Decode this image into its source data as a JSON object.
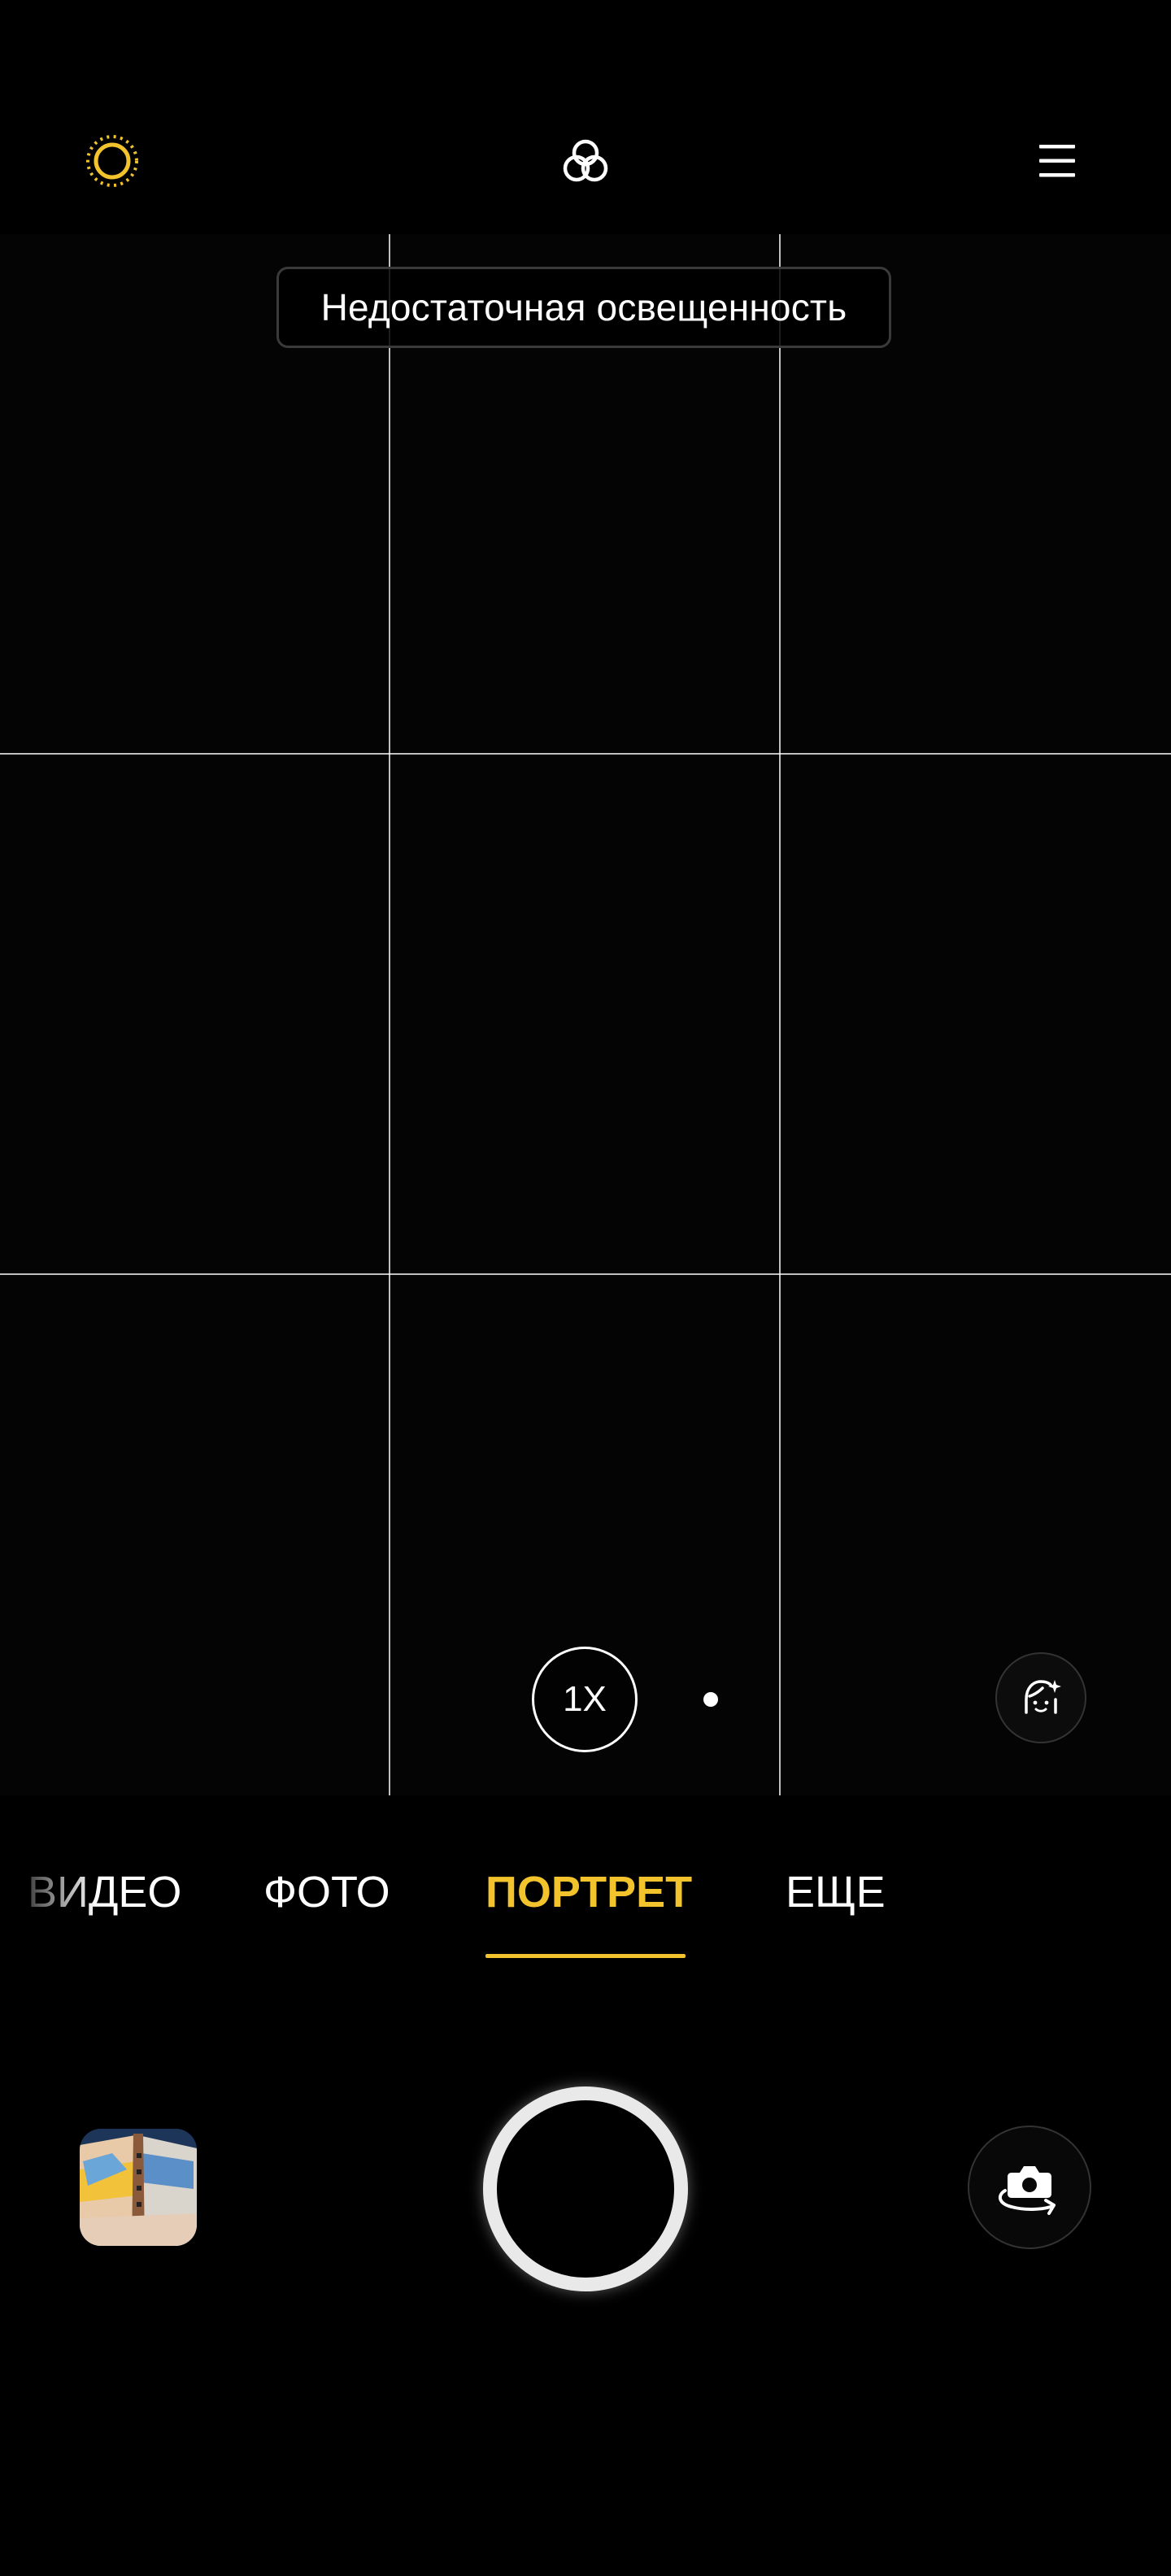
{
  "top_bar": {
    "flash_icon": "light-sun-icon",
    "filter_icon": "three-circles-filter-icon",
    "menu_icon": "hamburger-menu-icon",
    "accent_color": "#f2c32c"
  },
  "viewfinder": {
    "notice_text": "Недостаточная освещенность",
    "zoom_label": "1X",
    "beauty_icon": "face-beauty-icon"
  },
  "modes": {
    "items": [
      {
        "label": "ВИДЕО"
      },
      {
        "label": "ФОТО"
      },
      {
        "label": "ПОРТРЕТ"
      },
      {
        "label": "ЕЩЕ"
      }
    ],
    "selected": "ПОРТРЕТ",
    "selected_color": "#f2c32c"
  },
  "bottom_bar": {
    "gallery_icon": "gallery-thumbnail",
    "shutter_icon": "shutter-button",
    "switch_camera_icon": "camera-switch-icon"
  }
}
